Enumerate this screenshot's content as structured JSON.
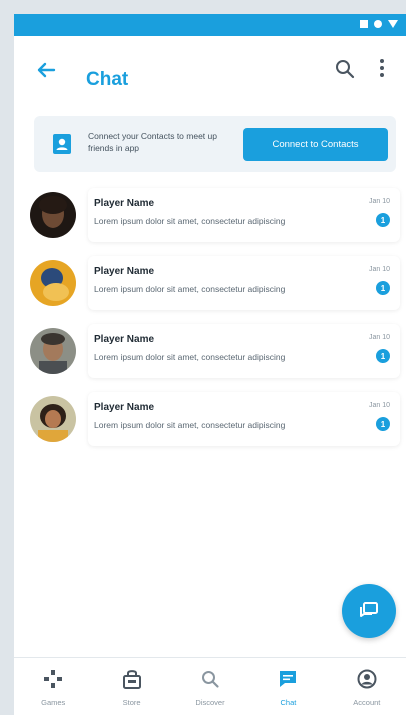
{
  "header": {
    "title": "Chat"
  },
  "contacts": {
    "text": "Connect your Contacts to meet up friends in app",
    "button_label": "Connect to Contacts"
  },
  "chats": [
    {
      "name": "Player Name",
      "preview": "Lorem ipsum dolor sit amet, consectetur adipiscing",
      "date": "Jan 10",
      "unread": "1",
      "avatar_color": "#3b2a22"
    },
    {
      "name": "Player Name",
      "preview": "Lorem ipsum dolor sit amet, consectetur adipiscing",
      "date": "Jan 10",
      "unread": "1",
      "avatar_color": "#e6a524"
    },
    {
      "name": "Player Name",
      "preview": "Lorem ipsum dolor sit amet, consectetur adipiscing",
      "date": "Jan 10",
      "unread": "1",
      "avatar_color": "#5f5a4e"
    },
    {
      "name": "Player Name",
      "preview": "Lorem ipsum dolor sit amet, consectetur adipiscing",
      "date": "Jan 10",
      "unread": "1",
      "avatar_color": "#6a5a3c"
    }
  ],
  "nav": [
    {
      "label": "Games",
      "icon": "gamepad-icon",
      "active": false
    },
    {
      "label": "Store",
      "icon": "store-icon",
      "active": false
    },
    {
      "label": "Discover",
      "icon": "search-icon",
      "active": false
    },
    {
      "label": "Chat",
      "icon": "chat-icon",
      "active": true
    },
    {
      "label": "Account",
      "icon": "account-icon",
      "active": false
    }
  ],
  "colors": {
    "accent": "#1a9fdd",
    "background": "#dfe5ea"
  }
}
